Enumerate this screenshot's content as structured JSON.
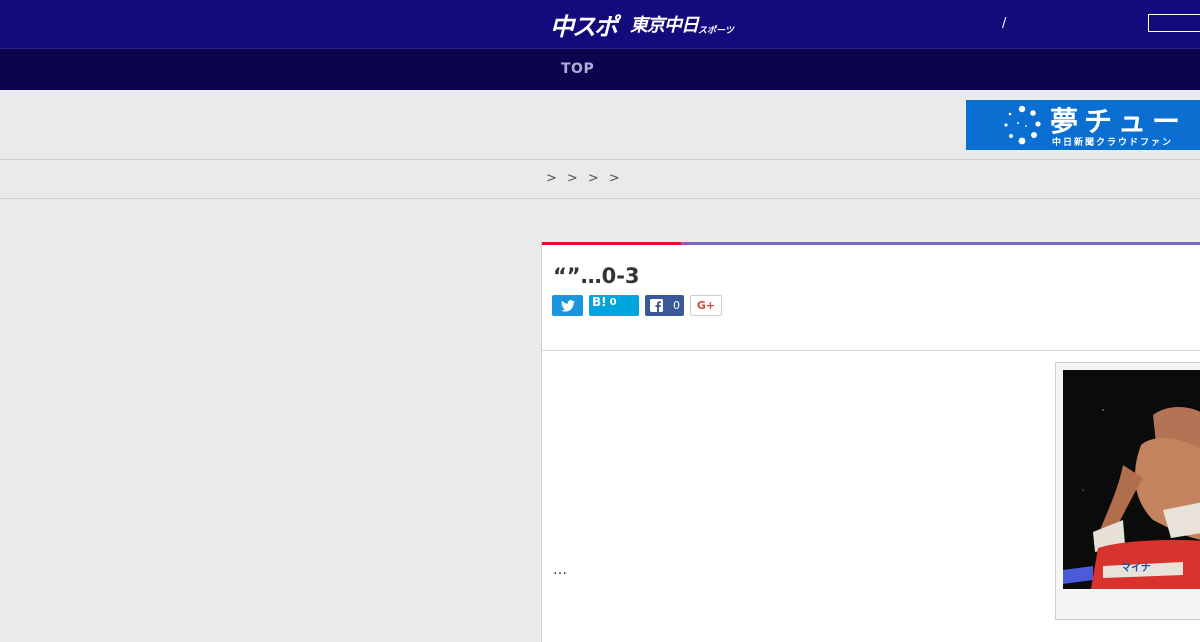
{
  "header": {
    "logo_part1": "中スポ",
    "logo_part2": "東京中日",
    "logo_part3": "スポーツ",
    "separator": "/"
  },
  "nav": {
    "items": [
      "TOP"
    ]
  },
  "banner": {
    "headline": "夢チュー",
    "subline": "中日新聞クラウドファン"
  },
  "breadcrumb": {
    "separators": [
      ">",
      ">",
      ">",
      ">"
    ]
  },
  "article": {
    "title": "“”…0-3",
    "share": {
      "twitter_icon": "twitter-bird-icon",
      "hatena_label": "B!",
      "hatena_count": "0",
      "facebook_icon": "facebook-f-icon",
      "facebook_count": "0",
      "gplus_label": "G+"
    },
    "body": "…",
    "photo_sponsor_text": "マイナ"
  },
  "colors": {
    "header_bg": "#130a7c",
    "nav_bg": "#0b0550",
    "accent_red": "#e60e2b",
    "accent_purple": "#7a67c1",
    "twitter": "#1b95e0",
    "hatena": "#00a4de",
    "facebook": "#3b5998",
    "banner_blue": "#0a6fd1"
  }
}
